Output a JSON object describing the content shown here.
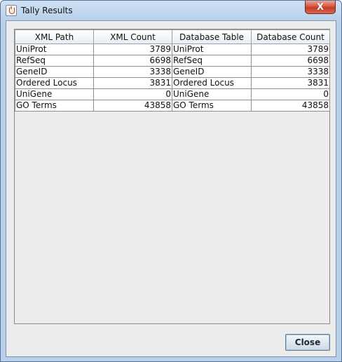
{
  "window": {
    "title": "Tally Results",
    "close_glyph": "X"
  },
  "table": {
    "columns": [
      "XML Path",
      "XML Count",
      "Database Table",
      "Database Count"
    ],
    "rows": [
      {
        "xml_path": "UniProt",
        "xml_count": "3789",
        "db_table": "UniProt",
        "db_count": "3789"
      },
      {
        "xml_path": "RefSeq",
        "xml_count": "6698",
        "db_table": "RefSeq",
        "db_count": "6698"
      },
      {
        "xml_path": "GeneID",
        "xml_count": "3338",
        "db_table": "GeneID",
        "db_count": "3338"
      },
      {
        "xml_path": "Ordered Locus",
        "xml_count": "3831",
        "db_table": "Ordered Locus",
        "db_count": "3831"
      },
      {
        "xml_path": "UniGene",
        "xml_count": "0",
        "db_table": "UniGene",
        "db_count": "0"
      },
      {
        "xml_path": "GO Terms",
        "xml_count": "43858",
        "db_table": "GO Terms",
        "db_count": "43858"
      }
    ]
  },
  "footer": {
    "close_label": "Close"
  }
}
